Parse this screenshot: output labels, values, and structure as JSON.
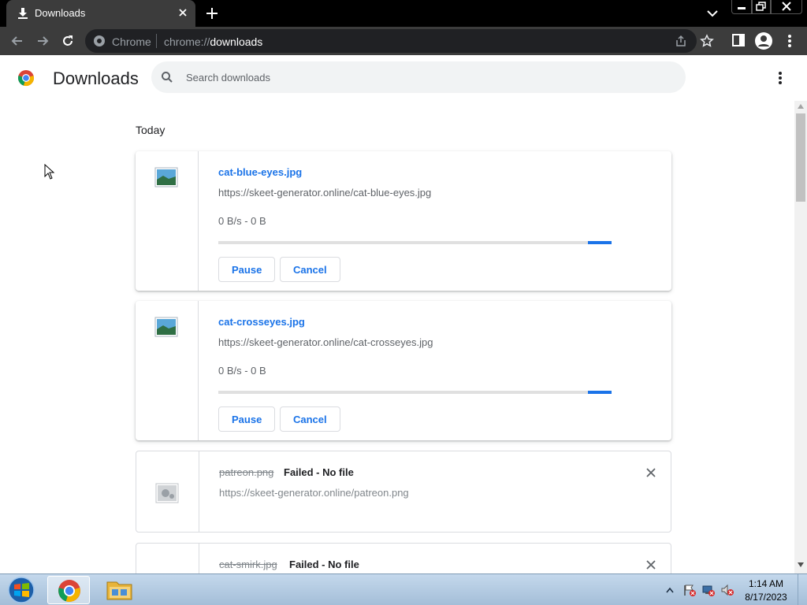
{
  "browser": {
    "tab": {
      "title": "Downloads"
    },
    "omnibox": {
      "chip": "Chrome",
      "scheme": "chrome://",
      "host": "downloads"
    }
  },
  "page": {
    "title": "Downloads",
    "search": {
      "placeholder": "Search downloads",
      "value": ""
    },
    "section_label": "Today"
  },
  "downloads": [
    {
      "name": "cat-blue-eyes.jpg",
      "url": "https://skeet-generator.online/cat-blue-eyes.jpg",
      "status": "0 B/s - 0 B",
      "progress": 0,
      "state": "in-progress",
      "pause_label": "Pause",
      "cancel_label": "Cancel"
    },
    {
      "name": "cat-crosseyes.jpg",
      "url": "https://skeet-generator.online/cat-crosseyes.jpg",
      "status": "0 B/s - 0 B",
      "progress": 0,
      "state": "in-progress",
      "pause_label": "Pause",
      "cancel_label": "Cancel"
    },
    {
      "name": "patreon.png",
      "url": "https://skeet-generator.online/patreon.png",
      "status": "Failed - No file",
      "state": "failed"
    },
    {
      "name": "cat-smirk.jpg",
      "status": "Failed - No file",
      "state": "failed"
    }
  ],
  "colors": {
    "accent": "#1a73e8",
    "toolbar": "#3c3c3c",
    "tabstrip": "#000000"
  },
  "taskbar": {
    "apps": [
      "chrome",
      "file-explorer"
    ],
    "clock": {
      "time": "1:14 AM",
      "date": "8/17/2023"
    }
  }
}
